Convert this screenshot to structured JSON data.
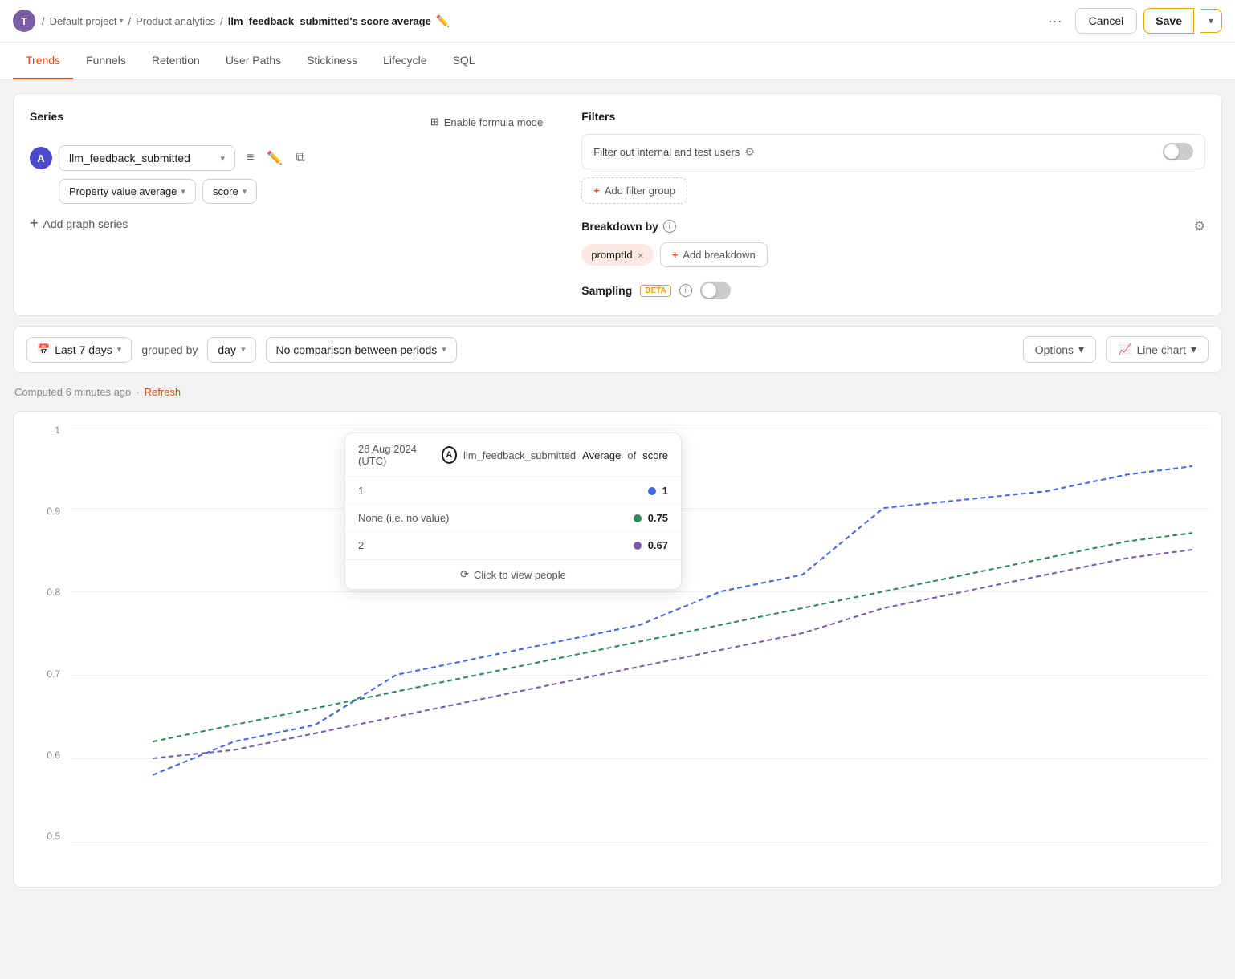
{
  "header": {
    "avatar_letter": "T",
    "breadcrumb": {
      "project": "Default project",
      "analytics": "Product analytics",
      "current": "llm_feedback_submitted's score average"
    },
    "more_label": "···",
    "cancel_label": "Cancel",
    "save_label": "Save"
  },
  "nav": {
    "tabs": [
      {
        "label": "Trends",
        "active": true
      },
      {
        "label": "Funnels",
        "active": false
      },
      {
        "label": "Retention",
        "active": false
      },
      {
        "label": "User Paths",
        "active": false
      },
      {
        "label": "Stickiness",
        "active": false
      },
      {
        "label": "Lifecycle",
        "active": false
      },
      {
        "label": "SQL",
        "active": false
      }
    ]
  },
  "series": {
    "title": "Series",
    "formula_label": "Enable formula mode",
    "series_a": {
      "letter": "A",
      "event": "llm_feedback_submitted"
    },
    "property_type": "Property value average",
    "property_name": "score",
    "add_series_label": "Add graph series"
  },
  "filters": {
    "title": "Filters",
    "internal_filter_label": "Filter out internal and test users",
    "internal_filter_active": false,
    "add_filter_label": "Add filter group"
  },
  "breakdown": {
    "label": "Breakdown by",
    "pills": [
      {
        "name": "promptId"
      }
    ],
    "add_breakdown_label": "Add breakdown"
  },
  "sampling": {
    "label": "Sampling",
    "beta_label": "BETA",
    "active": false
  },
  "toolbar": {
    "date_range": "Last 7 days",
    "grouped_by_label": "grouped by",
    "group_interval": "day",
    "comparison": "No comparison between periods",
    "options_label": "Options",
    "chart_type_label": "Line chart"
  },
  "computed": {
    "text": "Computed 6 minutes ago",
    "dot": "·",
    "refresh_label": "Refresh"
  },
  "chart": {
    "y_labels": [
      "1",
      "0.9",
      "0.8",
      "0.7",
      "0.6",
      "0.5"
    ],
    "tooltip": {
      "date": "28 Aug 2024 (UTC)",
      "series_letter": "A",
      "series_name": "llm_feedback_submitted",
      "metric_label": "Average",
      "of_label": "of",
      "property": "score",
      "rows": [
        {
          "label": "1",
          "value": "1",
          "dot_color": "#4169e1"
        },
        {
          "label": "None (i.e. no value)",
          "value": "0.75",
          "dot_color": "#2e8b57"
        },
        {
          "label": "2",
          "value": "0.67",
          "dot_color": "#7b5ea7"
        }
      ],
      "footer_label": "Click to view people"
    }
  }
}
